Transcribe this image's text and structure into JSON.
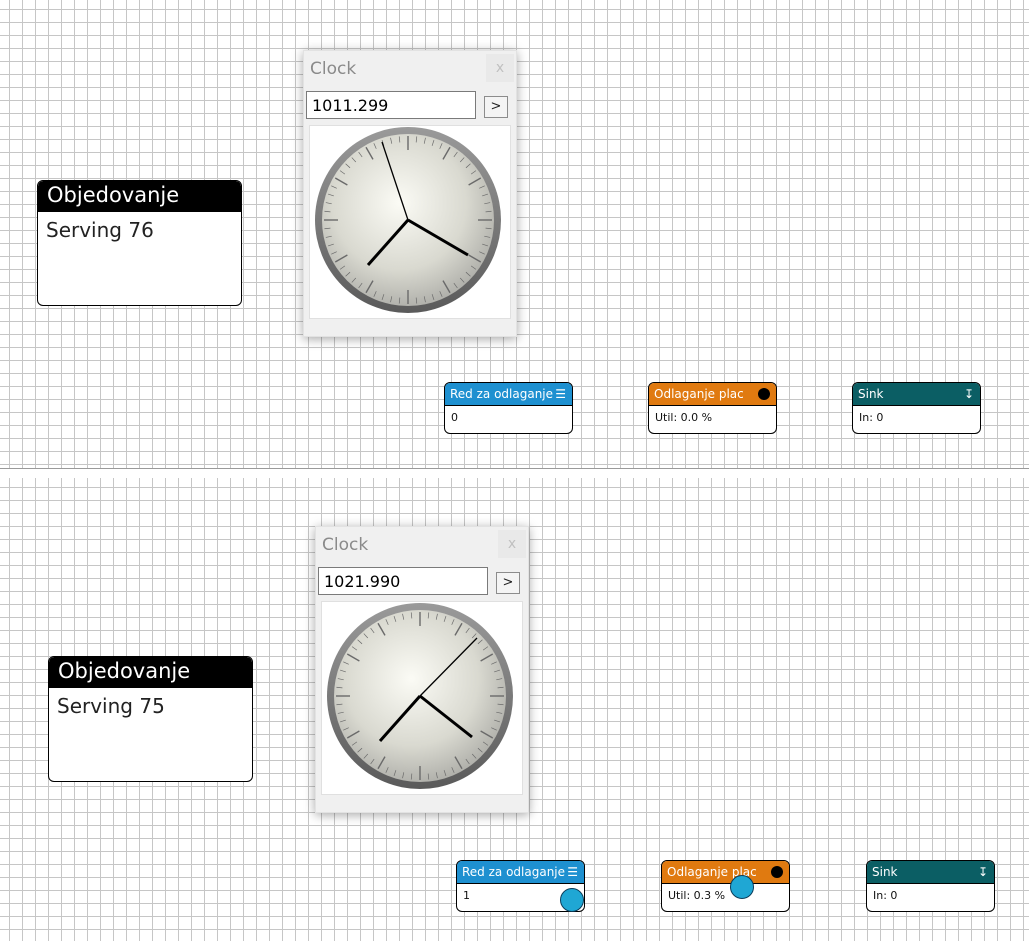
{
  "panels": [
    {
      "node": {
        "title": "Objedovanje",
        "body": "Serving 76"
      },
      "clock": {
        "title": "Clock",
        "close": "x",
        "time": "1011.299",
        "go": ">"
      },
      "blocks": {
        "queue": {
          "title": "Red za odlaganje",
          "value": "0"
        },
        "server": {
          "title": "Odlaganje plac",
          "value": "Util: 0.0 %"
        },
        "sink": {
          "title": "Sink",
          "value": "In: 0"
        }
      }
    },
    {
      "node": {
        "title": "Objedovanje",
        "body": "Serving 75"
      },
      "clock": {
        "title": "Clock",
        "close": "x",
        "time": "1021.990",
        "go": ">"
      },
      "blocks": {
        "queue": {
          "title": "Red za odlaganje",
          "value": "1"
        },
        "server": {
          "title": "Odlaganje plac",
          "value": "Util: 0.3 %"
        },
        "sink": {
          "title": "Sink",
          "value": "In: 0"
        }
      }
    }
  ],
  "icons": {
    "queue": "queue-icon",
    "server": "server-dot-icon",
    "sink": "sink-arrow-icon",
    "entity": "entity-dot"
  },
  "colors": {
    "queue": "#1e90d0",
    "server": "#e07a10",
    "sink": "#0b5e64",
    "entity": "#1fa7d4",
    "grid": "#c6c6c6"
  }
}
